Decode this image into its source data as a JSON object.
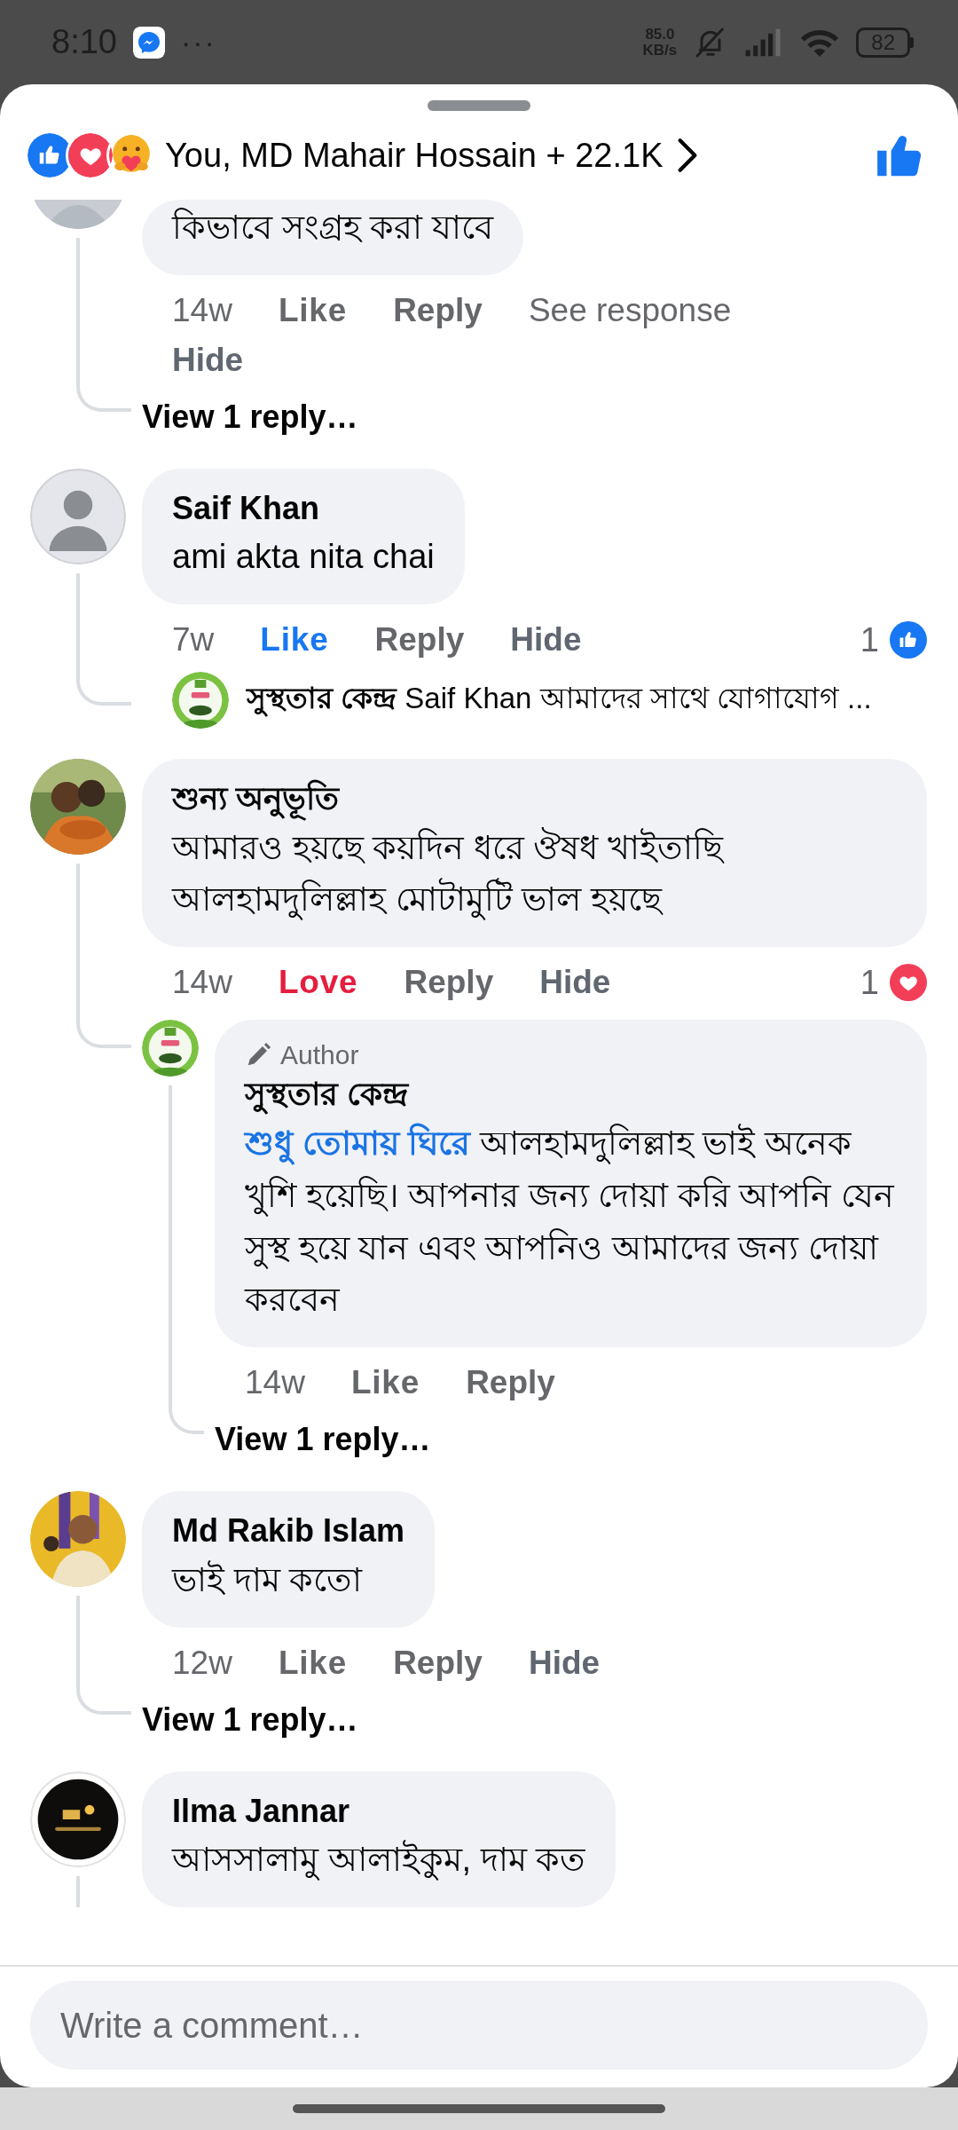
{
  "status_bar": {
    "time": "8:10",
    "more": "···",
    "speed_value": "85.0",
    "speed_unit": "KB/s",
    "battery": "82"
  },
  "header": {
    "reactions": [
      {
        "kind": "like"
      },
      {
        "kind": "love"
      },
      {
        "kind": "care"
      }
    ],
    "summary": "You, MD Mahair Hossain + 22.1K",
    "liked": true
  },
  "comments": [
    {
      "avatar": {
        "kind": "snapshot"
      },
      "cut_off": true,
      "text": "কিভাবে সংগ্রহ করা যাবে",
      "time": "14w",
      "actions": [
        {
          "label": "Like",
          "kind": "react"
        },
        {
          "label": "Reply",
          "kind": "reply"
        },
        {
          "label": "See response",
          "kind": "link"
        },
        {
          "label": "Hide",
          "kind": "hide"
        }
      ],
      "replies": [
        {
          "kind": "more",
          "label": "View 1 reply…"
        }
      ]
    },
    {
      "avatar": {
        "kind": "silhouette"
      },
      "cut_off": false,
      "author": "Saif Khan",
      "text": "ami akta nita chai",
      "time": "7w",
      "actions": [
        {
          "label": "Like",
          "kind": "liked"
        },
        {
          "label": "Reply",
          "kind": "reply"
        },
        {
          "label": "Hide",
          "kind": "hide"
        }
      ],
      "reaction_count": {
        "count": "1",
        "kind": "like"
      },
      "replies": [
        {
          "kind": "preview",
          "avatar": {
            "kind": "leafmark"
          },
          "author": "সুস্থতার কেন্দ্র",
          "text": "Saif Khan আমাদের সাথে যোগাযোগ ..."
        }
      ]
    },
    {
      "avatar": {
        "kind": "forest"
      },
      "cut_off": false,
      "author": "শুন্য অনুভূতি",
      "text": "আমারও হয়ছে কয়দিন ধরে ঔষধ খাইতাছি আলহামদুলিল্লাহ মোটামুটি ভাল হয়ছে",
      "time": "14w",
      "actions": [
        {
          "label": "Love",
          "kind": "loved"
        },
        {
          "label": "Reply",
          "kind": "reply"
        },
        {
          "label": "Hide",
          "kind": "hide"
        }
      ],
      "reaction_count": {
        "count": "1",
        "kind": "love"
      },
      "replies": [
        {
          "kind": "comment",
          "avatar": {
            "kind": "leafmark"
          },
          "cut_off": false,
          "badge": "Author",
          "author": "সুস্থতার কেন্দ্র",
          "tag": "শুধু তোমায় ঘিরে",
          "text": "আলহামদুলিল্লাহ ভাই অনেক খুশি হয়েছি। আপনার জন্য দোয়া করি আপনি যেন সুস্থ হয়ে যান এবং আপনিও আমাদের জন্য দোয়া করবেন",
          "time": "14w",
          "actions": [
            {
              "label": "Like",
              "kind": "react"
            },
            {
              "label": "Reply",
              "kind": "reply"
            }
          ],
          "replies": [
            {
              "kind": "more",
              "label": "View 1 reply…"
            }
          ]
        }
      ]
    },
    {
      "avatar": {
        "kind": "portrait"
      },
      "cut_off": false,
      "author": "Md Rakib Islam",
      "text": "ভাই দাম কতো",
      "time": "12w",
      "actions": [
        {
          "label": "Like",
          "kind": "react"
        },
        {
          "label": "Reply",
          "kind": "reply"
        },
        {
          "label": "Hide",
          "kind": "hide"
        }
      ],
      "replies": [
        {
          "kind": "more",
          "label": "View 1 reply…"
        }
      ]
    },
    {
      "avatar": {
        "kind": "darkmark"
      },
      "cut_off": false,
      "author": "Ilma Jannar",
      "text": "আসসালামু আলাইকুম, দাম কত",
      "continues": true
    }
  ],
  "composer": {
    "placeholder": "Write a comment…"
  }
}
